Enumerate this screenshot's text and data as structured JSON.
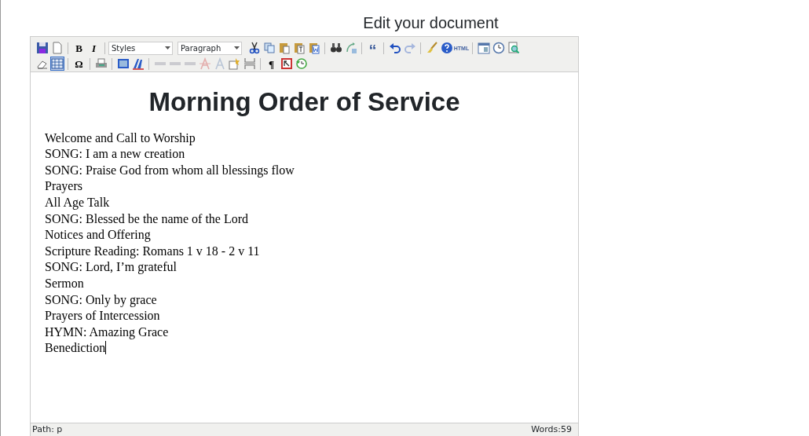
{
  "page_title": "Edit your document",
  "toolbar_rows": [
    [
      {
        "kind": "save",
        "active": false,
        "disabled": false
      },
      {
        "kind": "new",
        "active": false,
        "disabled": false
      },
      {
        "kind": "sep"
      },
      {
        "kind": "bold-glyph",
        "label": "B",
        "active": false,
        "disabled": false
      },
      {
        "kind": "italic-glyph",
        "label": "I",
        "active": false,
        "disabled": false
      },
      {
        "kind": "sep"
      },
      {
        "kind": "select",
        "value": "Styles"
      },
      {
        "kind": "select",
        "value": "Paragraph"
      },
      {
        "kind": "cut",
        "active": false,
        "disabled": false
      },
      {
        "kind": "copy",
        "active": false,
        "disabled": false
      },
      {
        "kind": "paste",
        "active": false,
        "disabled": false
      },
      {
        "kind": "paste-text",
        "active": false,
        "disabled": false
      },
      {
        "kind": "paste-word",
        "active": false,
        "disabled": false
      },
      {
        "kind": "sep"
      },
      {
        "kind": "find",
        "active": false,
        "disabled": false
      },
      {
        "kind": "replace",
        "active": false,
        "disabled": false
      },
      {
        "kind": "sep"
      },
      {
        "kind": "quote-glyph",
        "label": "“",
        "active": false,
        "disabled": false
      },
      {
        "kind": "sep"
      },
      {
        "kind": "undo",
        "active": false,
        "disabled": false
      },
      {
        "kind": "redo",
        "active": false,
        "disabled": true
      },
      {
        "kind": "sep"
      },
      {
        "kind": "cleanup",
        "active": false,
        "disabled": false
      },
      {
        "kind": "help",
        "active": false,
        "disabled": false
      },
      {
        "kind": "tag-glyph",
        "label": "HTML",
        "active": false,
        "disabled": false
      },
      {
        "kind": "sep"
      },
      {
        "kind": "date",
        "active": false,
        "disabled": false
      },
      {
        "kind": "time",
        "active": false,
        "disabled": false
      },
      {
        "kind": "preview",
        "active": false,
        "disabled": false
      }
    ],
    [
      {
        "kind": "eraser",
        "active": false,
        "disabled": false
      },
      {
        "kind": "table",
        "active": true,
        "disabled": false
      },
      {
        "kind": "sep"
      },
      {
        "kind": "bold-glyph",
        "label": "Ω",
        "active": false,
        "disabled": false
      },
      {
        "kind": "sep"
      },
      {
        "kind": "print",
        "active": false,
        "disabled": false
      },
      {
        "kind": "sep"
      },
      {
        "kind": "frame",
        "active": false,
        "disabled": false
      },
      {
        "kind": "styleprops",
        "active": false,
        "disabled": false
      },
      {
        "kind": "sep"
      },
      {
        "kind": "mini",
        "active": false,
        "disabled": true
      },
      {
        "kind": "mini",
        "active": false,
        "disabled": true
      },
      {
        "kind": "mini",
        "active": false,
        "disabled": true
      },
      {
        "kind": "strike-a",
        "active": false,
        "disabled": true
      },
      {
        "kind": "plain-a",
        "active": false,
        "disabled": true
      },
      {
        "kind": "attribs",
        "active": false,
        "disabled": false
      },
      {
        "kind": "pagebreak",
        "active": false,
        "disabled": false
      },
      {
        "kind": "sep"
      },
      {
        "kind": "bold-glyph",
        "label": "¶",
        "active": false,
        "disabled": false
      },
      {
        "kind": "visualchars",
        "active": false,
        "disabled": false
      },
      {
        "kind": "restore",
        "active": false,
        "disabled": false
      }
    ]
  ],
  "document": {
    "heading": "Morning Order of Service",
    "lines": [
      "Welcome and Call to Worship",
      "SONG: I am a new creation",
      "SONG: Praise God from whom all blessings flow",
      "Prayers",
      "All Age Talk",
      "SONG: Blessed be the name of the Lord",
      "Notices and Offering",
      "Scripture Reading: Romans 1 v 18 - 2 v 11",
      "SONG: Lord, I’m grateful",
      "Sermon",
      "SONG: Only by grace",
      "Prayers of Intercession",
      "HYMN: Amazing Grace",
      "Benediction"
    ]
  },
  "status_bar": {
    "path": "Path: p",
    "words": "Words:59"
  }
}
